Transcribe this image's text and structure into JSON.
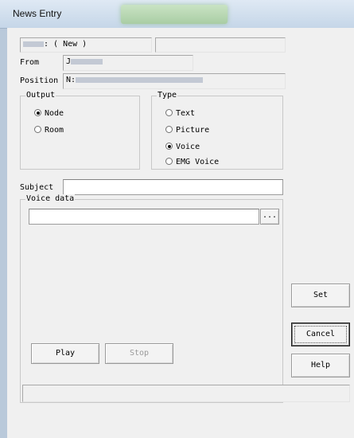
{
  "window": {
    "title": "News Entry"
  },
  "header": {
    "new_label": ": ( New )",
    "extra_value": ""
  },
  "from": {
    "label": "From",
    "value": "J"
  },
  "position": {
    "label": "Position",
    "value": "N:"
  },
  "output": {
    "label": "Output",
    "options": [
      {
        "label": "Node",
        "checked": true
      },
      {
        "label": "Room",
        "checked": false
      }
    ]
  },
  "type": {
    "label": "Type",
    "options": [
      {
        "label": "Text",
        "checked": false
      },
      {
        "label": "Picture",
        "checked": false
      },
      {
        "label": "Voice",
        "checked": true
      },
      {
        "label": "EMG Voice",
        "checked": false
      }
    ]
  },
  "subject": {
    "label": "Subject",
    "value": ""
  },
  "voice_data": {
    "label": "Voice data",
    "path_value": "",
    "browse_label": "..."
  },
  "buttons": {
    "play": "Play",
    "stop": "Stop",
    "set": "Set",
    "cancel": "Cancel",
    "help": "Help"
  },
  "status": {
    "text": ""
  }
}
